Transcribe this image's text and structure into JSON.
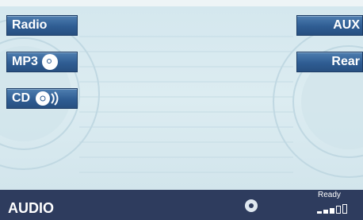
{
  "left_buttons": [
    {
      "label": "Radio",
      "icon": ""
    },
    {
      "label": "MP3",
      "icon": "disc-icon"
    },
    {
      "label": "CD",
      "icon": "cd-sound-icon"
    }
  ],
  "right_buttons": [
    {
      "label": "AUX"
    },
    {
      "label": "Rear"
    }
  ],
  "status_bar": {
    "title": "AUDIO",
    "ready_label": "Ready",
    "media_icon": "disc-icon",
    "signal_icon": "signal-strength-icon"
  },
  "colors": {
    "button": "#2f5d93",
    "status_bar": "#2e3c5e",
    "background": "#d4e7ee"
  }
}
